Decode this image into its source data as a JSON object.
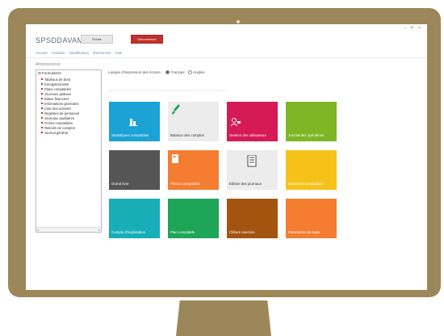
{
  "app": {
    "title": "SPSDDAVAM",
    "btn_a": "Fiches",
    "btn_b": "Déconnexion"
  },
  "window_controls": "– ⇱ ×",
  "menu": [
    "Accueil",
    "Création",
    "Modification",
    "Recherche",
    "Aide"
  ],
  "tree": {
    "title": "Arborescence",
    "root": "Formulaires",
    "items": [
      "Tableaux de bord",
      "Enregistrements",
      "Plans comptables",
      "Journaux globaux",
      "Bilans financiers",
      "Informations générales",
      "Liste des activités",
      "Registres de personnel",
      "Journaux auxiliaires",
      "Fiches comptables",
      "Relevés de comptes",
      "Journal général"
    ],
    "scroll_left": "◂",
    "scroll_right": "▸"
  },
  "language": {
    "label": "Langue d'impression des écrans :",
    "options": [
      "Français",
      "Anglais"
    ],
    "selected": "Français"
  },
  "tiles": [
    {
      "label": "Statistiques comptables",
      "color": "#1aa3d4",
      "icon": "bar-chart-icon",
      "light": false
    },
    {
      "label": "Balance des comptes",
      "color": "#ececec",
      "icon": "brush-icon",
      "light": true
    },
    {
      "label": "Gestion des utilisateurs",
      "color": "#d51a57",
      "icon": "users-icon",
      "light": false
    },
    {
      "label": "Journal des opérations",
      "color": "#7db726",
      "icon": "",
      "light": false
    },
    {
      "label": "Grand livre",
      "color": "#555555",
      "icon": "",
      "light": false
    },
    {
      "label": "Pièces comptables",
      "color": "#f47d31",
      "icon": "document-icon",
      "light": false
    },
    {
      "label": "Édition des journaux",
      "color": "#ececec",
      "icon": "report-icon",
      "light": true
    },
    {
      "label": "Exercices comptables",
      "color": "#f6c21a",
      "icon": "",
      "light": false
    },
    {
      "label": "Compte d'exploitation",
      "color": "#17aeb8",
      "icon": "",
      "light": false
    },
    {
      "label": "Plan comptable",
      "color": "#1ea557",
      "icon": "",
      "light": false
    },
    {
      "label": "Clôture exercice",
      "color": "#a35510",
      "icon": "",
      "light": false
    },
    {
      "label": "Paramètres de base",
      "color": "#f47d31",
      "icon": "",
      "light": false
    }
  ]
}
